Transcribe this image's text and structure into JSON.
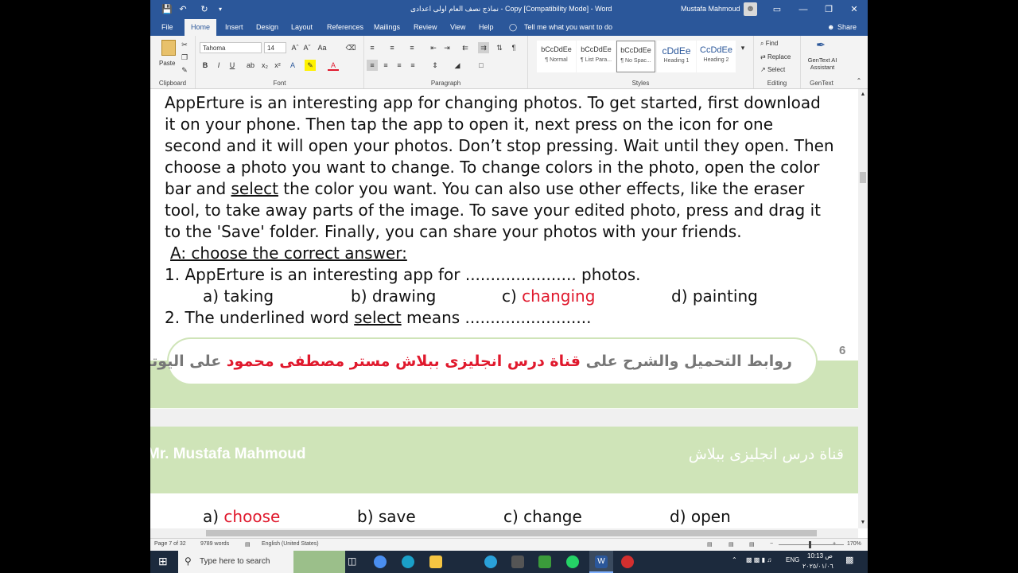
{
  "titlebar": {
    "doc_title": "نماذج نصف العام اولى اعدادى - Copy [Compatibility Mode] - Word",
    "user": "Mustafa Mahmoud",
    "save_icon": "save-icon",
    "undo_icon": "undo-icon",
    "redo_icon": "redo-icon",
    "minimize": "—",
    "restore": "❐",
    "close": "✕",
    "ribbon_display": "▭"
  },
  "tabs": [
    "File",
    "Home",
    "Insert",
    "Design",
    "Layout",
    "References",
    "Mailings",
    "Review",
    "View",
    "Help"
  ],
  "tell_me": "Tell me what you want to do",
  "share": "Share",
  "ribbon": {
    "clipboard": {
      "label": "Clipboard",
      "paste": "Paste"
    },
    "font": {
      "label": "Font",
      "name": "Tahoma",
      "size": "14"
    },
    "paragraph": {
      "label": "Paragraph"
    },
    "styles": {
      "label": "Styles",
      "items": [
        {
          "preview": "bCcDdEe",
          "name": "¶ Normal"
        },
        {
          "preview": "bCcDdEe",
          "name": "¶ List Para..."
        },
        {
          "preview": "bCcDdEe",
          "name": "¶ No Spac..."
        },
        {
          "preview": "cDdEe",
          "name": "Heading 1"
        },
        {
          "preview": "CcDdEe",
          "name": "Heading 2"
        }
      ]
    },
    "editing": {
      "label": "Editing",
      "find": "Find",
      "replace": "Replace",
      "select": "Select"
    },
    "gentext": {
      "label": "GenText",
      "button": "GenText AI Assistant"
    }
  },
  "doc": {
    "passage_lines": [
      "AppErture is an interesting app for changing photos. To get started, first download",
      "it on your phone. Then tap the app to open it, next press on the icon for one",
      "second and it will open your photos. Don’t stop pressing. Wait until they open. Then",
      "choose a photo you want to change. To change colors in the photo, open the color",
      "bar and ",
      "select",
      " the color you want. You can also use other effects, like the eraser",
      "tool, to take away parts of the image. To save your edited photo, press and drag it",
      "to the 'Save' folder. Finally, you can share your photos with your friends."
    ],
    "section_heading": "A: choose the correct answer:",
    "q1": {
      "question": "1. AppErture is an interesting app for ...................... photos.",
      "a": "a) taking",
      "b": "b) drawing",
      "c_prefix": "c) ",
      "c": "changing",
      "d": "d) painting"
    },
    "q2": {
      "prefix": "2. The underlined word ",
      "word": "select",
      "suffix": " means .........................",
      "a_prefix": "a) ",
      "a": "choose",
      "b": "b) save",
      "c": "c) change",
      "d": "d) open"
    },
    "footer_link_gray1": "روابط التحميل والشرح على ",
    "footer_link_red": "قناة درس انجليزى ببلاش مستر مصطفى محمود",
    "footer_link_gray2": " على اليوتيوب",
    "page_number": "6",
    "header_left": "Mr. Mustafa Mahmoud",
    "header_right": "قناة درس انجليزى ببلاش"
  },
  "status": {
    "page": "Page 7 of 32",
    "words": "9789 words",
    "language": "English (United States)",
    "zoom": "170%"
  },
  "taskbar": {
    "search_placeholder": "Type here to search",
    "lang": "ENG",
    "time": "10:13 ص",
    "date": "٢٠٢٥/٠١/٠٦"
  },
  "colors": {
    "word_blue": "#2b579a",
    "accent_red": "#e0192d",
    "banner_green": "#cfe4b8"
  }
}
